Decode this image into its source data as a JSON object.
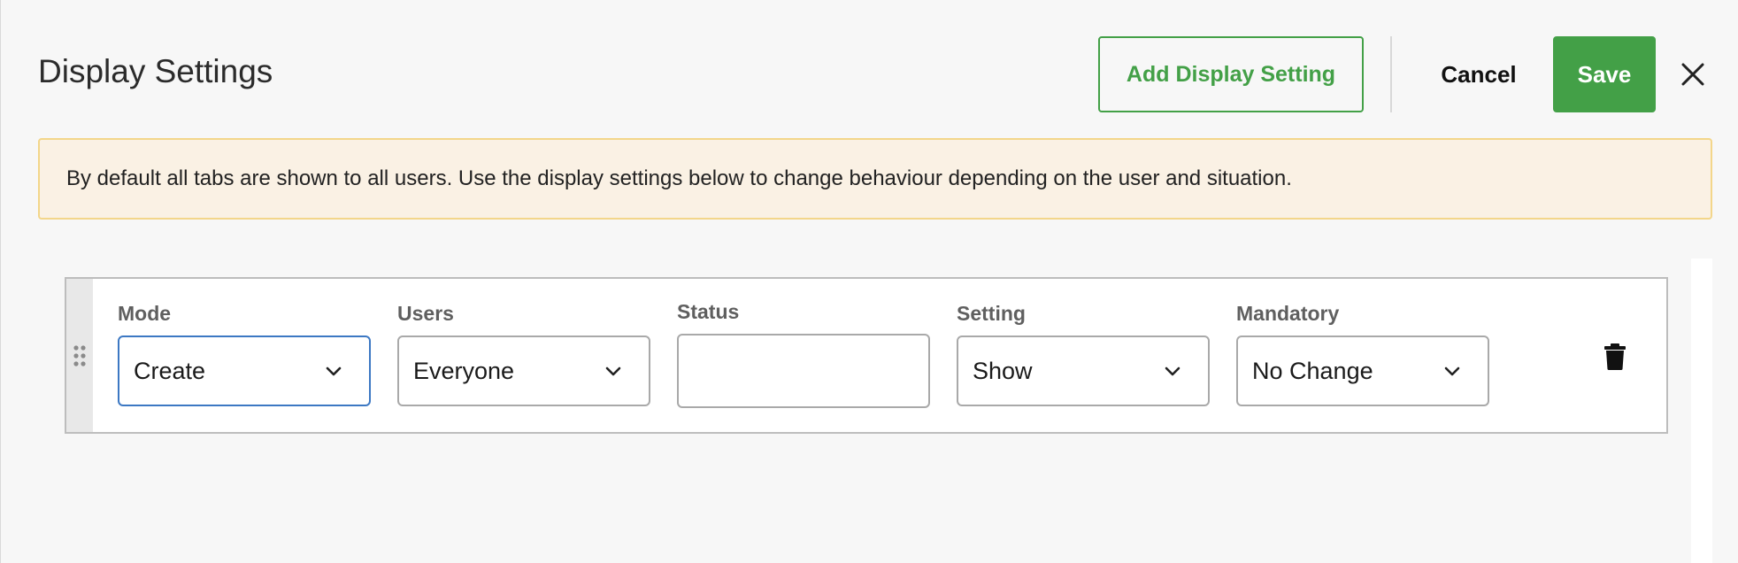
{
  "header": {
    "title": "Display Settings",
    "add_label": "Add Display Setting",
    "cancel_label": "Cancel",
    "save_label": "Save"
  },
  "notice": {
    "text": "By default all tabs are shown to all users. Use the display settings below to change behaviour depending on the user and situation."
  },
  "row": {
    "mode": {
      "label": "Mode",
      "value": "Create"
    },
    "users": {
      "label": "Users",
      "value": "Everyone"
    },
    "status": {
      "label": "Status",
      "value": ""
    },
    "setting": {
      "label": "Setting",
      "value": "Show"
    },
    "mandatory": {
      "label": "Mandatory",
      "value": "No Change"
    }
  },
  "colors": {
    "primary_green": "#43a047",
    "notice_bg": "#faf1e4",
    "notice_border": "#f3d68a",
    "focus_blue": "#3c78c3"
  },
  "icons": {
    "close": "close-icon",
    "drag": "drag-handle-icon",
    "chevron": "chevron-down-icon",
    "delete": "trash-icon"
  }
}
